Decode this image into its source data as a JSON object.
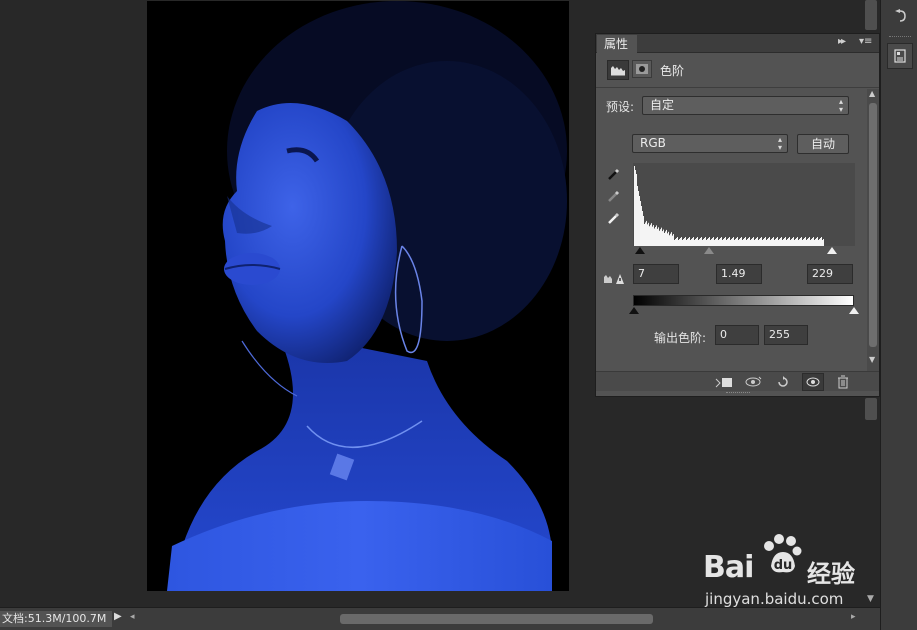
{
  "properties_panel": {
    "tab_label": "属性",
    "title": "色阶",
    "preset_label": "预设:",
    "preset_value": "自定",
    "channel_value": "RGB",
    "auto_label": "自动",
    "input_levels": {
      "black": "7",
      "gamma": "1.49",
      "white": "229"
    },
    "output_label": "输出色阶:",
    "output_levels": {
      "black": "0",
      "white": "255"
    },
    "icons": [
      "levels-adjustment-icon",
      "mask-icon",
      "black-eyedropper-icon",
      "gray-eyedropper-icon",
      "white-eyedropper-icon",
      "clipping-warning-icon",
      "clip-to-layer-icon",
      "view-previous-icon",
      "reset-icon",
      "eye-icon",
      "trash-icon"
    ]
  },
  "status_bar": {
    "doc_size": "文档:51.3M/100.7M"
  },
  "watermark": {
    "brand": "Bai",
    "product": "经验",
    "url": "jingyan.baidu.com"
  },
  "colors": {
    "workspace_bg": "#282828",
    "panel_bg": "#535353",
    "photo_tint": "#1f46d6"
  }
}
